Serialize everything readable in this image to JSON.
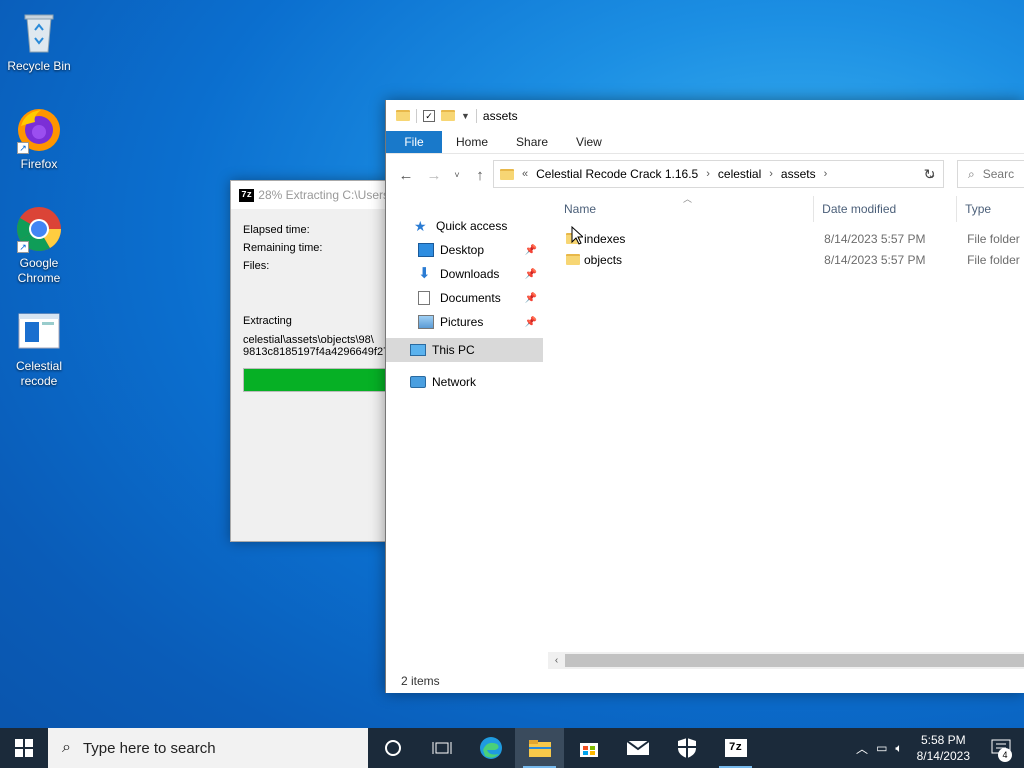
{
  "desktop": {
    "icons": [
      {
        "label": "Recycle Bin",
        "icon": "recycle-bin-icon"
      },
      {
        "label": "Firefox",
        "icon": "firefox-icon"
      },
      {
        "label": "Google Chrome",
        "icon": "chrome-icon"
      },
      {
        "label": "Celestial recode",
        "icon": "app-icon"
      }
    ]
  },
  "zip": {
    "title": "28% Extracting C:\\Users",
    "elapsed_label": "Elapsed time:",
    "remaining_label": "Remaining time:",
    "files_label": "Files:",
    "extracting_label": "Extracting",
    "path_line1": "celestial\\assets\\objects\\98\\",
    "path_line2": "9813c8185197f4a4296649f27",
    "progress_percent": 100
  },
  "explorer": {
    "title": "assets",
    "ribbon_tabs": [
      "File",
      "Home",
      "Share",
      "View"
    ],
    "breadcrumb": {
      "overflow": "«",
      "items": [
        "Celestial Recode Crack 1.16.5",
        "celestial",
        "assets"
      ]
    },
    "search_placeholder": "Searc",
    "nav": {
      "quick_access": "Quick access",
      "desktop": "Desktop",
      "downloads": "Downloads",
      "documents": "Documents",
      "pictures": "Pictures",
      "this_pc": "This PC",
      "network": "Network"
    },
    "columns": [
      "Name",
      "Date modified",
      "Type"
    ],
    "files": [
      {
        "name": "indexes",
        "date": "8/14/2023 5:57 PM",
        "type": "File folder"
      },
      {
        "name": "objects",
        "date": "8/14/2023 5:57 PM",
        "type": "File folder"
      }
    ],
    "status": "2 items"
  },
  "taskbar": {
    "search_placeholder": "Type here to search",
    "time": "5:58 PM",
    "date": "8/14/2023",
    "notification_count": "4"
  },
  "colors": {
    "accent": "#1979ca",
    "progress": "#06b025",
    "taskbar": "#1b2a3a"
  }
}
